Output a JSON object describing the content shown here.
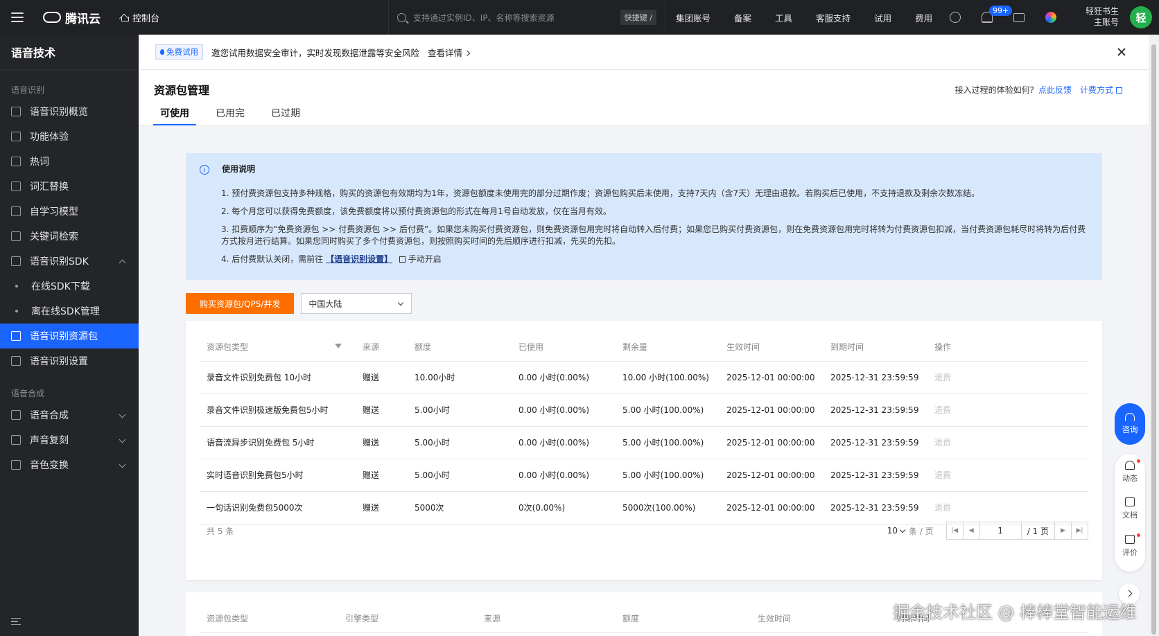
{
  "topbar": {
    "brand": "腾讯云",
    "console": "控制台",
    "search_placeholder": "支持通过实例ID、IP、名称等搜索资源",
    "shortcut": "快捷键 /",
    "links": [
      "集团账号",
      "备案",
      "工具",
      "客服支持",
      "试用",
      "费用"
    ],
    "badge": "99+",
    "user_name": "轻狂书生",
    "user_role": "主账号",
    "avatar": "轻"
  },
  "sidebar": {
    "title": "语音技术",
    "groups": [
      {
        "label": "语音识别",
        "items": [
          {
            "label": "语音识别概览",
            "icon": "dashboard-icon"
          },
          {
            "label": "功能体验",
            "icon": "grid-icon"
          },
          {
            "label": "热词",
            "icon": "edit-icon"
          },
          {
            "label": "词汇替换",
            "icon": "replace-icon"
          },
          {
            "label": "自学习模型",
            "icon": "model-icon"
          },
          {
            "label": "关键词检索",
            "icon": "search-doc-icon"
          },
          {
            "label": "语音识别SDK",
            "icon": "sdk-icon"
          },
          {
            "label": "在线SDK下载",
            "icon": "dot-icon"
          },
          {
            "label": "离在线SDK管理",
            "icon": "dot-icon"
          },
          {
            "label": "语音识别资源包",
            "icon": "package-icon"
          },
          {
            "label": "语音识别设置",
            "icon": "settings-icon"
          }
        ]
      },
      {
        "label": "语音合成",
        "items": [
          {
            "label": "语音合成",
            "icon": "synth-icon"
          },
          {
            "label": "声音复刻",
            "icon": "clone-icon"
          },
          {
            "label": "音色变换",
            "icon": "voice-icon"
          }
        ]
      }
    ]
  },
  "notice": {
    "tag": "免费试用",
    "text": "邀您试用数据安全审计，实时发现数据泄露等安全风险",
    "link": "查看详情"
  },
  "page": {
    "title": "资源包管理",
    "feedback_q": "接入过程的体验如何?",
    "feedback_link": "点此反馈",
    "billing_link": "计费方式",
    "tabs": [
      "可使用",
      "已用完",
      "已过期"
    ]
  },
  "info": {
    "title": "使用说明",
    "items": [
      "1. 预付费资源包支持多种规格，购买的资源包有效期均为1年，资源包额度未使用完的部分过期作废；资源包购买后未使用，支持7天内（含7天）无理由退款。若购买后已使用，不支持退款及剩余次数冻结。",
      "2. 每个月您可以获得免费额度，该免费额度将以预付费资源包的形式在每月1号自动发放，仅在当月有效。",
      "3. 扣费顺序为“免费资源包 >> 付费资源包 >> 后付费”。如果您未购买付费资源包，则免费资源包用完时将自动转入后付费；如果您已购买付费资源包，则在免费资源包用完时将转为付费资源包扣减，当付费资源包耗尽时将转为后付费方式按月进行结算。如果您同时购买了多个付费资源包，则按照购买时间的先后顺序进行扣减，先买的先扣。",
      "4. 后付费默认关闭，需前往"
    ],
    "item4_link": "【语音识别设置】",
    "item4_suffix": "手动开启"
  },
  "toolbar": {
    "buy_label": "购买资源包/QPS/并发",
    "region": "中国大陆"
  },
  "table": {
    "columns": [
      "资源包类型",
      "来源",
      "额度",
      "已使用",
      "剩余量",
      "生效时间",
      "到期时间",
      "操作"
    ],
    "rows": [
      [
        "录音文件识别免费包 10小时",
        "赠送",
        "10.00小时",
        "0.00 小时(0.00%)",
        "10.00 小时(100.00%)",
        "2025-12-01 00:00:00",
        "2025-12-31 23:59:59",
        "退费"
      ],
      [
        "录音文件识别极速版免费包5小时",
        "赠送",
        "5.00小时",
        "0.00 小时(0.00%)",
        "5.00 小时(100.00%)",
        "2025-12-01 00:00:00",
        "2025-12-31 23:59:59",
        "退费"
      ],
      [
        "语音流异步识别免费包 5小时",
        "赠送",
        "5.00小时",
        "0.00 小时(0.00%)",
        "5.00 小时(100.00%)",
        "2025-12-01 00:00:00",
        "2025-12-31 23:59:59",
        "退费"
      ],
      [
        "实时语音识别免费包5小时",
        "赠送",
        "5.00小时",
        "0.00 小时(0.00%)",
        "5.00 小时(100.00%)",
        "2025-12-01 00:00:00",
        "2025-12-31 23:59:59",
        "退费"
      ],
      [
        "一句话识别免费包5000次",
        "赠送",
        "5000次",
        "0次(0.00%)",
        "5000次(100.00%)",
        "2025-12-01 00:00:00",
        "2025-12-31 23:59:59",
        "退费"
      ]
    ],
    "total": "共 5 条",
    "page_size": "10",
    "per_page": "条 / 页",
    "current_page": "1",
    "total_pages": "/ 1 页"
  },
  "table2": {
    "columns": [
      "资源包类型",
      "引擎类型",
      "来源",
      "额度",
      "生效时间",
      "到期时间"
    ]
  },
  "floating": {
    "consult": "咨询",
    "items": [
      "动态",
      "文档",
      "评价"
    ]
  },
  "watermark": "掘金技术社区 @ 棒棒堂智能运维"
}
